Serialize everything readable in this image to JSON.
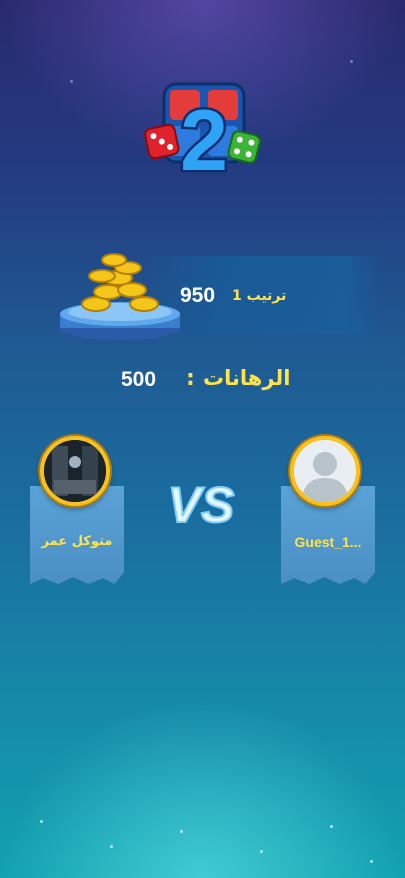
{
  "logo": {
    "number": "2",
    "icon": "ludo-board-with-dice"
  },
  "reward": {
    "amount": "950",
    "rank_label": "ترتيب 1",
    "icon": "coin-pile-on-pedestal"
  },
  "bets": {
    "label": "الرهانات",
    "separator": ":",
    "value": "500"
  },
  "vs_label": "VS",
  "players": {
    "left": {
      "name": "متوكل عمر",
      "avatar": "photo-avatar"
    },
    "right": {
      "name": "Guest_1...",
      "avatar": "default-user-avatar"
    }
  },
  "colors": {
    "accent": "#ffe34a",
    "panel": "#4b8fc4",
    "ring": "#f7c220"
  }
}
